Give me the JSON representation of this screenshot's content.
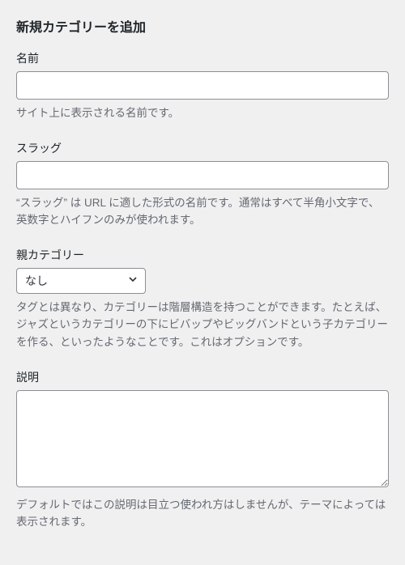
{
  "form": {
    "title": "新規カテゴリーを追加",
    "name": {
      "label": "名前",
      "value": "",
      "description": "サイト上に表示される名前です。"
    },
    "slug": {
      "label": "スラッグ",
      "value": "",
      "description": "“スラッグ” は URL に適した形式の名前です。通常はすべて半角小文字で、英数字とハイフンのみが使われます。"
    },
    "parent": {
      "label": "親カテゴリー",
      "selected": "なし",
      "description": "タグとは異なり、カテゴリーは階層構造を持つことができます。たとえば、ジャズというカテゴリーの下にビバップやビッグバンドという子カテゴリーを作る、といったようなことです。これはオプションです。"
    },
    "description": {
      "label": "説明",
      "value": "",
      "description": "デフォルトではこの説明は目立つ使われ方はしませんが、テーマによっては表示されます。"
    }
  }
}
